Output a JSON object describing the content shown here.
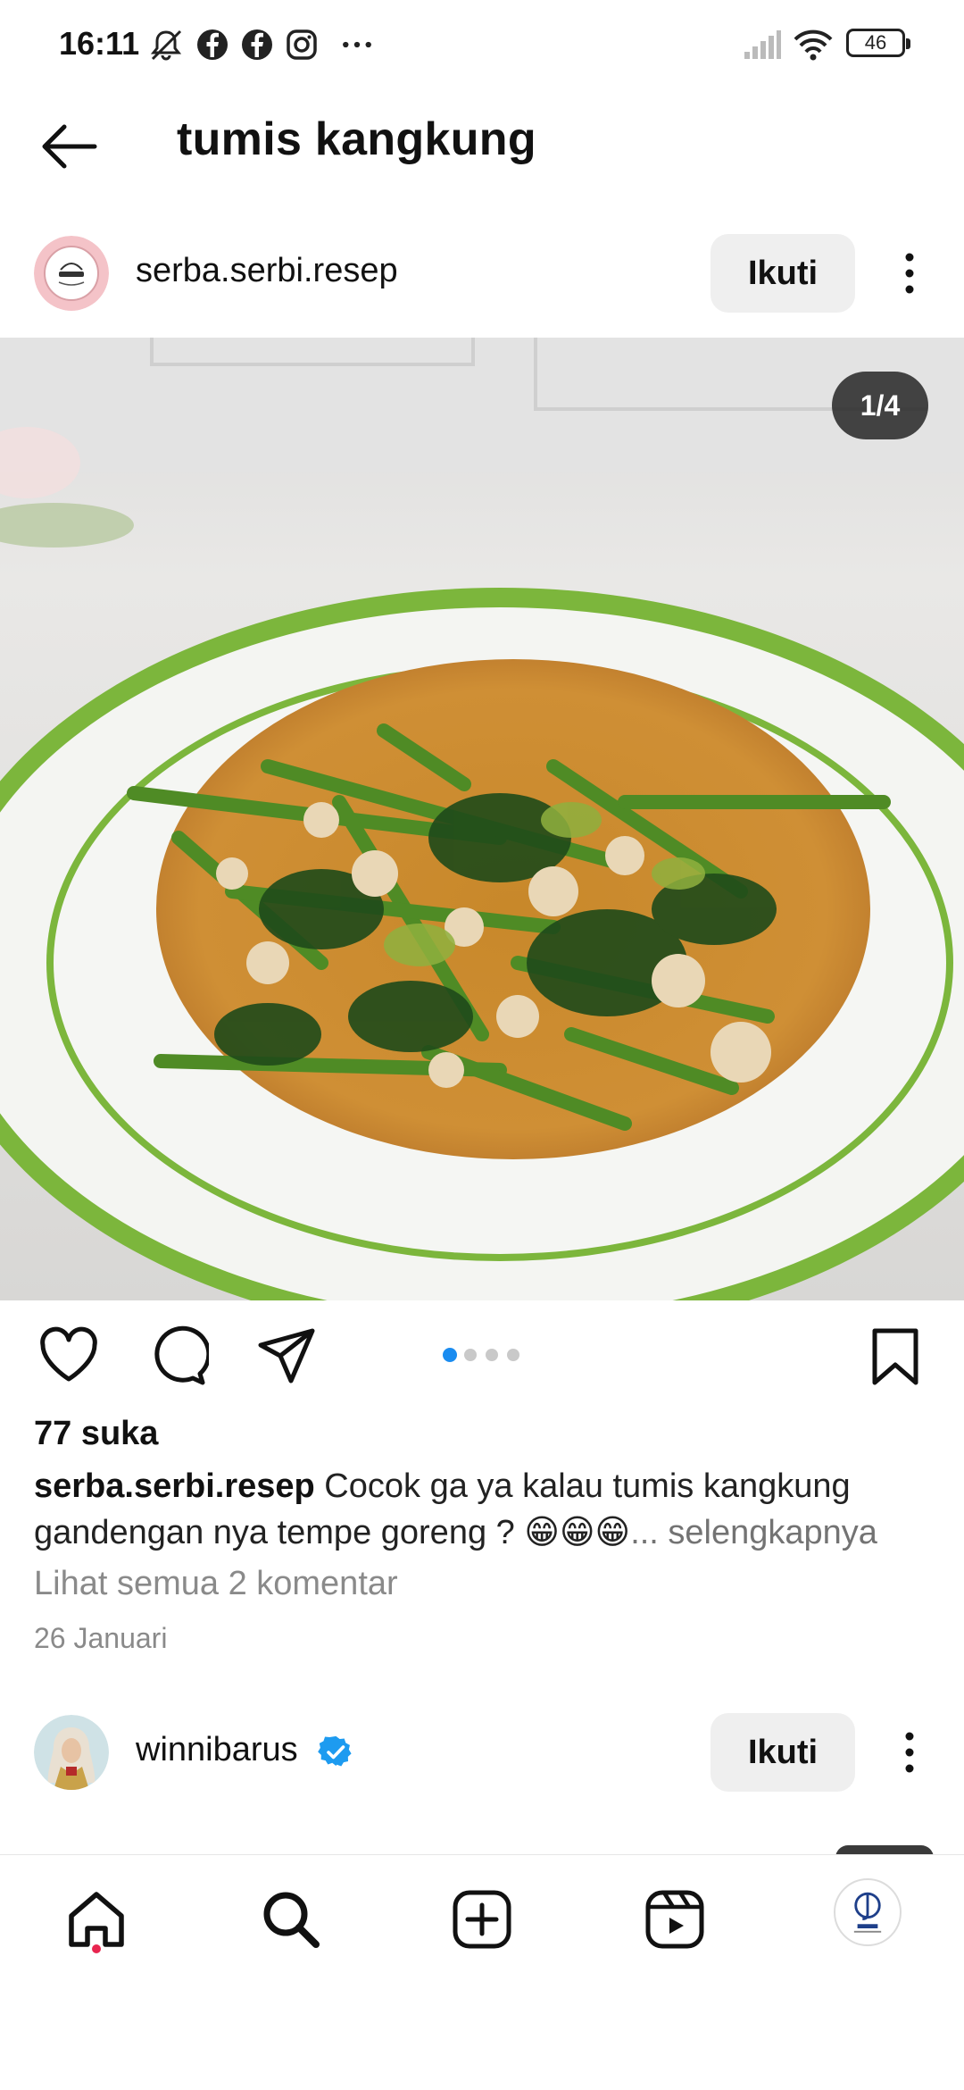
{
  "status_bar": {
    "time": "16:11",
    "battery": "46",
    "icons": [
      "mute-icon",
      "facebook-icon",
      "facebook-icon",
      "instagram-icon",
      "more-notifications-icon",
      "signal-icon",
      "wifi-icon",
      "battery-icon"
    ]
  },
  "header": {
    "title": "tumis kangkung",
    "back_icon": "arrow-left-icon"
  },
  "post": {
    "username": "serba.serbi.resep",
    "follow_label": "Ikuti",
    "page_indicator": "1/4",
    "carousel_pages": 4,
    "carousel_active": 1,
    "likes": "77 suka",
    "caption_user": "serba.serbi.resep",
    "caption_text": " Cocok ga ya kalau tumis kangkung gandengan nya tempe goreng ? 😁😁😁",
    "caption_more": "... selengkapnya",
    "view_comments": "Lihat semua 2 komentar",
    "date": "26 Januari"
  },
  "next_post": {
    "username": "winnibarus",
    "follow_label": "Ikuti",
    "verified": true
  },
  "bottom_nav": {
    "items": [
      "home-icon",
      "search-icon",
      "create-icon",
      "reels-icon",
      "profile-avatar"
    ]
  },
  "colors": {
    "accent_blue": "#1a8cf0",
    "verified_blue": "#1d9bf0",
    "notification_red": "#e8254f",
    "button_bg": "#efefef"
  }
}
